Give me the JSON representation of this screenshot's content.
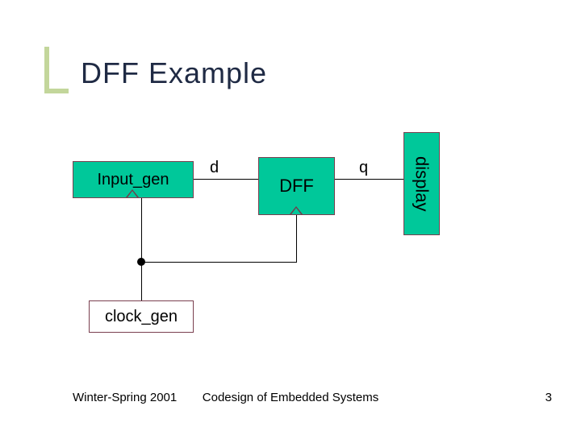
{
  "title": "DFF Example",
  "blocks": {
    "input_gen": "Input_gen",
    "dff": "DFF",
    "display": "display",
    "clock_gen": "clock_gen"
  },
  "signals": {
    "d": "d",
    "q": "q"
  },
  "footer": {
    "left": "Winter-Spring 2001",
    "center": "Codesign of Embedded Systems",
    "page": "3"
  },
  "colors": {
    "block_fill": "#00c89a",
    "block_border": "#7a3f4f",
    "accent": "#c3d69b",
    "title_color": "#1f2a44"
  }
}
